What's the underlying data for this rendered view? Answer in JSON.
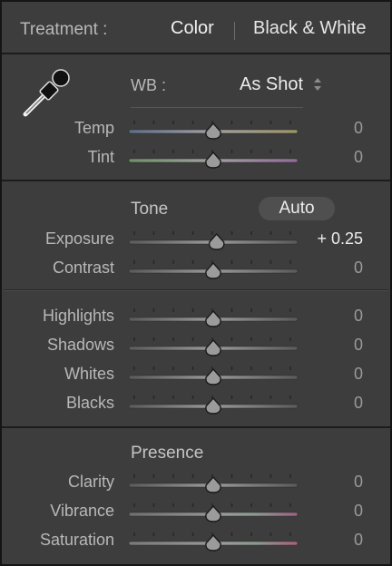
{
  "treatment": {
    "label": "Treatment :",
    "color": "Color",
    "bw": "Black & White"
  },
  "wb": {
    "label": "WB :",
    "value": "As Shot"
  },
  "tone": {
    "heading": "Tone",
    "auto_label": "Auto"
  },
  "presence": {
    "heading": "Presence"
  },
  "rows": [
    {
      "key": "temp",
      "label": "Temp",
      "value": "0",
      "position": 0.5,
      "track": "temp"
    },
    {
      "key": "tint",
      "label": "Tint",
      "value": "0",
      "position": 0.5,
      "track": "tint"
    },
    {
      "key": "exposure",
      "label": "Exposure",
      "value": "+ 0.25",
      "position": 0.52,
      "track": "gray",
      "active": true
    },
    {
      "key": "contrast",
      "label": "Contrast",
      "value": "0",
      "position": 0.5,
      "track": "gray"
    },
    {
      "key": "highlights",
      "label": "Highlights",
      "value": "0",
      "position": 0.5,
      "track": "gray"
    },
    {
      "key": "shadows",
      "label": "Shadows",
      "value": "0",
      "position": 0.5,
      "track": "gray"
    },
    {
      "key": "whites",
      "label": "Whites",
      "value": "0",
      "position": 0.5,
      "track": "gray"
    },
    {
      "key": "blacks",
      "label": "Blacks",
      "value": "0",
      "position": 0.5,
      "track": "gray"
    },
    {
      "key": "clarity",
      "label": "Clarity",
      "value": "0",
      "position": 0.5,
      "track": "gray"
    },
    {
      "key": "vibrance",
      "label": "Vibrance",
      "value": "0",
      "position": 0.5,
      "track": "vibrance"
    },
    {
      "key": "saturation",
      "label": "Saturation",
      "value": "0",
      "position": 0.5,
      "track": "saturation"
    }
  ],
  "colors": {
    "background": "#3d3d3d",
    "divider": "#1c1c1c",
    "thumb": "#9b9b9b",
    "text": "#b8b8b8",
    "active_text": "#ececec"
  },
  "icons": {
    "eyedropper": "eyedropper-icon",
    "updown": "updown-arrows-icon"
  }
}
